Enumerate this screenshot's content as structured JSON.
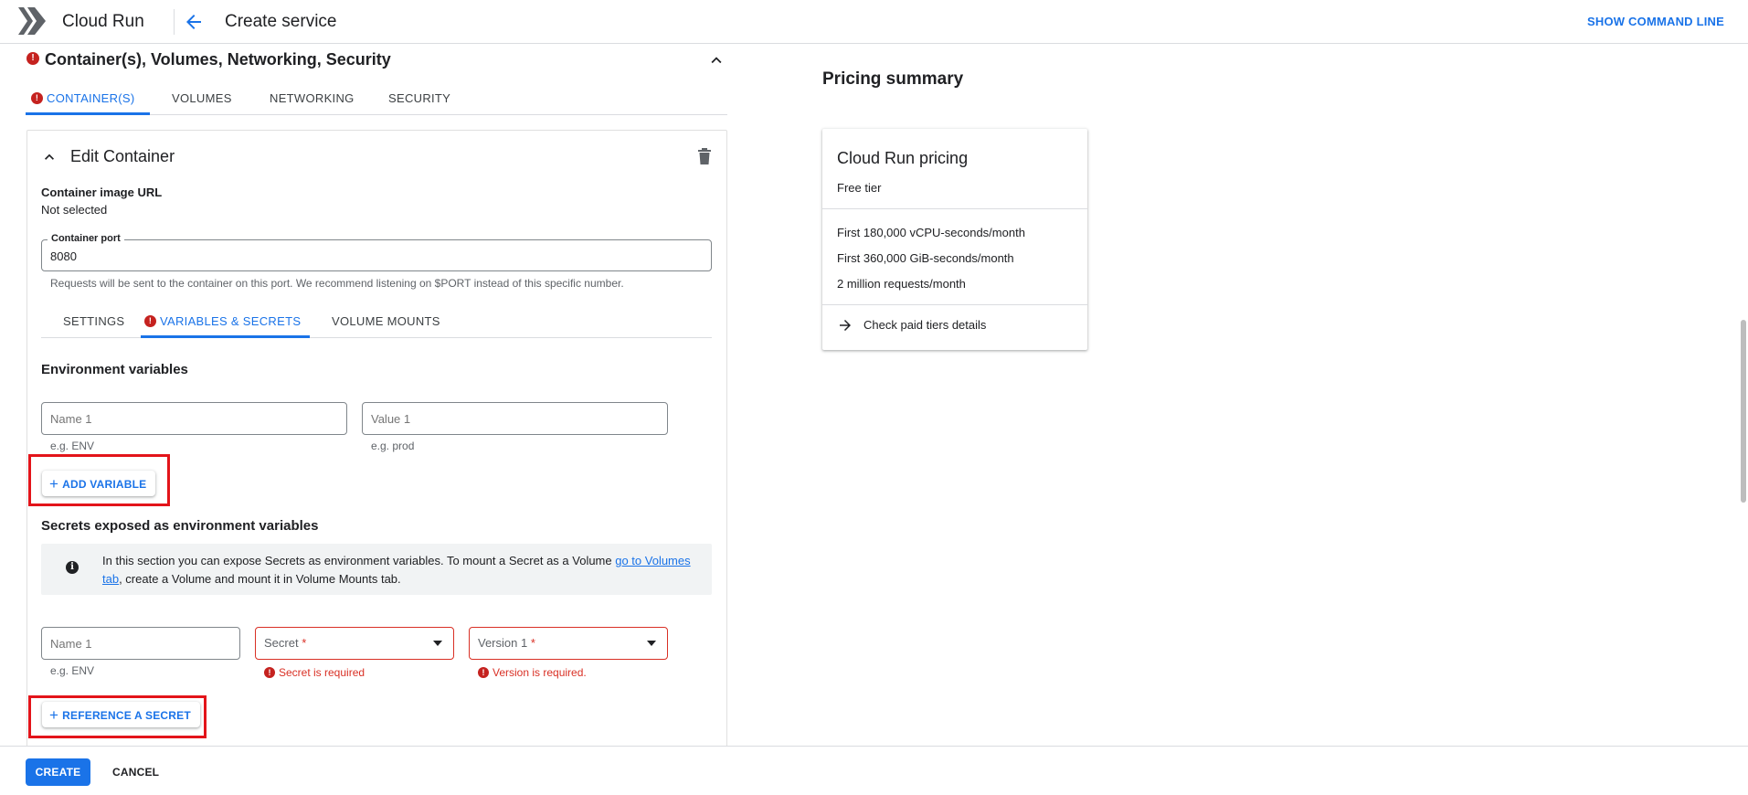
{
  "header": {
    "app_name": "Cloud Run",
    "page_title": "Create service",
    "show_command_line": "SHOW COMMAND LINE"
  },
  "section": {
    "title": "Container(s), Volumes, Networking, Security",
    "tabs": [
      {
        "label": "CONTAINER(S)",
        "active": true,
        "error": true
      },
      {
        "label": "VOLUMES"
      },
      {
        "label": "NETWORKING"
      },
      {
        "label": "SECURITY"
      }
    ]
  },
  "container": {
    "title": "Edit Container",
    "image_url_label": "Container image URL",
    "image_url_value": "Not selected",
    "port_label": "Container port",
    "port_value": "8080",
    "port_hint": "Requests will be sent to the container on this port. We recommend listening on $PORT instead of this specific number.",
    "subtabs": [
      {
        "label": "SETTINGS"
      },
      {
        "label": "VARIABLES & SECRETS",
        "active": true,
        "error": true
      },
      {
        "label": "VOLUME MOUNTS"
      }
    ]
  },
  "env": {
    "heading": "Environment variables",
    "name_placeholder": "Name 1",
    "value_placeholder": "Value 1",
    "name_hint": "e.g. ENV",
    "value_hint": "e.g. prod",
    "add_button": "ADD VARIABLE"
  },
  "secrets": {
    "heading": "Secrets exposed as environment variables",
    "info_text_before": "In this section you can expose Secrets as environment variables. To mount a Secret as a Volume ",
    "info_link": "go to Volumes tab",
    "info_text_after": ", create a Volume and mount it in Volume Mounts tab.",
    "name_placeholder": "Name 1",
    "name_hint": "e.g. ENV",
    "secret_label": "Secret",
    "secret_required_mark": "*",
    "secret_error": "Secret is required",
    "version_label": "Version 1",
    "version_required_mark": "*",
    "version_error": "Version is required.",
    "reference_button": "REFERENCE A SECRET"
  },
  "footer": {
    "create": "CREATE",
    "cancel": "CANCEL"
  },
  "pricing": {
    "heading": "Pricing summary",
    "card_title": "Cloud Run pricing",
    "tier": "Free tier",
    "lines": [
      "First 180,000 vCPU-seconds/month",
      "First 360,000 GiB-seconds/month",
      "2 million requests/month"
    ],
    "link": "Check paid tiers details"
  },
  "colors": {
    "accent": "#1a73e8",
    "error": "#d93025",
    "highlight_box": "#e3141a"
  }
}
